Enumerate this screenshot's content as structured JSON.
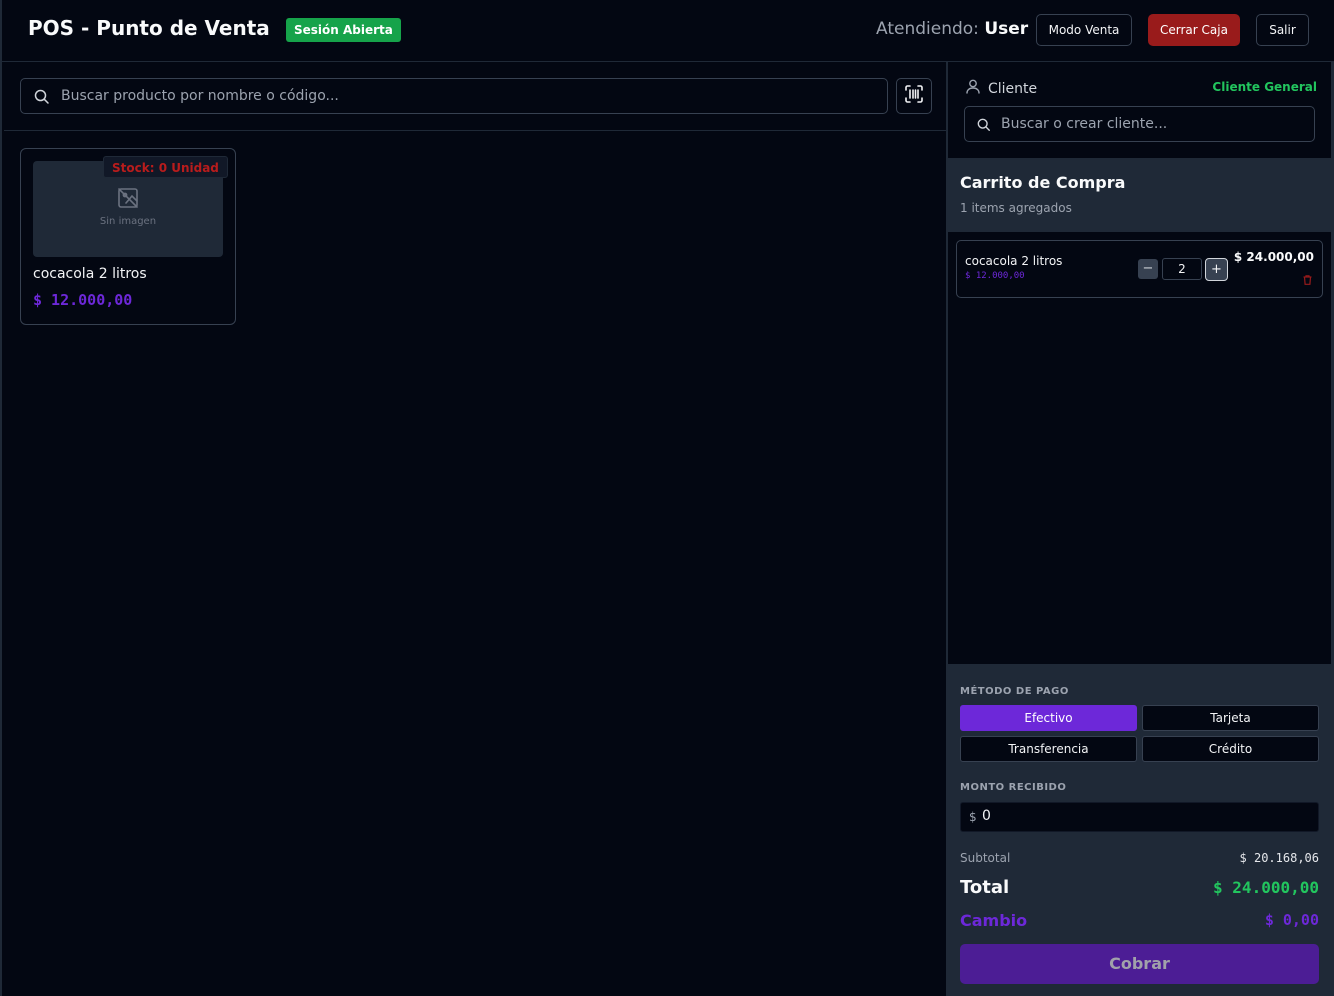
{
  "header": {
    "title": "POS - Punto de Venta",
    "session_badge": "Sesión Abierta",
    "attending_label": "Atendiendo:",
    "attending_user": "User",
    "mode_button": "Modo Venta",
    "close_register_button": "Cerrar Caja",
    "exit_button": "Salir",
    "close_register_color": "#991b1b"
  },
  "products": {
    "search_placeholder": "Buscar producto por nombre o código...",
    "items": [
      {
        "name": "cocacola 2 litros",
        "price": "$ 12.000,00",
        "stock": "Stock: 0 Unidad",
        "no_image_text": "Sin imagen"
      }
    ]
  },
  "client": {
    "label": "Cliente",
    "selected": "Cliente General",
    "search_placeholder": "Buscar o crear cliente..."
  },
  "cart": {
    "title": "Carrito de Compra",
    "count_text": "1 items agregados",
    "items": [
      {
        "name": "cocacola 2 litros",
        "unit_price": "$ 12.000,00",
        "quantity": "2",
        "line_total": "$ 24.000,00"
      }
    ]
  },
  "payment": {
    "method_label": "MÉTODO DE PAGO",
    "methods": [
      "Efectivo",
      "Tarjeta",
      "Transferencia",
      "Crédito"
    ],
    "selected_method": "Efectivo",
    "amount_label": "MONTO RECIBIDO",
    "currency_symbol": "$",
    "amount_value": "0",
    "subtotal_label": "Subtotal",
    "subtotal_value": "$ 20.168,06",
    "total_label": "Total",
    "total_value": "$ 24.000,00",
    "change_label": "Cambio",
    "change_value": "$ 0,00",
    "charge_button": "Cobrar",
    "accent_color": "#6d28d9",
    "success_color": "#22c55e"
  }
}
